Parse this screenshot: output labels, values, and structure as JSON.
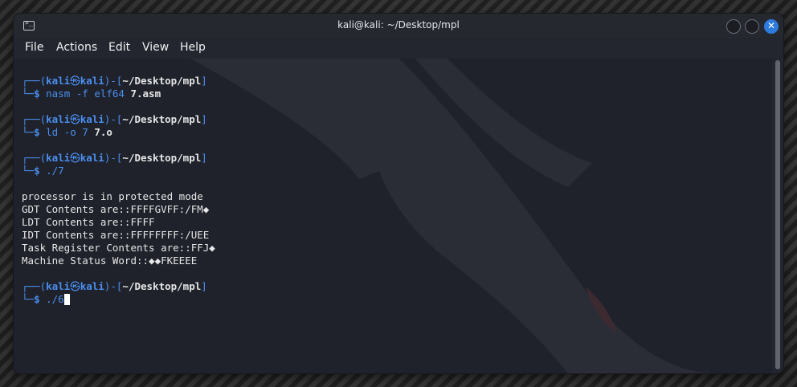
{
  "window": {
    "title": "kali@kali: ~/Desktop/mpl"
  },
  "menu": {
    "file": "File",
    "actions": "Actions",
    "edit": "Edit",
    "view": "View",
    "help": "Help"
  },
  "prompt": {
    "open": "┌──(",
    "user": "kali",
    "at": "㉿",
    "host": "kali",
    "mid": ")-[",
    "dir": "~/Desktop/mpl",
    "close": "]",
    "line2": "└─",
    "dollar": "$"
  },
  "commands": [
    {
      "cmd": "nasm -f elf64 ",
      "arg": "7.asm"
    },
    {
      "cmd": "ld -o 7 ",
      "arg": "7.o"
    },
    {
      "cmd": "./7",
      "arg": ""
    },
    {
      "cmd": "./6",
      "arg": ""
    }
  ],
  "output": [
    "processor is in protected mode",
    "GDT Contents are::FFFFGVFF:/FM◆",
    "LDT Contents are::FFFF",
    "IDT Contents are::FFFFFFFF:/UEE",
    "Task Register Contents are::FFJ◆",
    "Machine Status Word::◆◆FKEEEE"
  ],
  "colors": {
    "accent": "#4a8ff0",
    "close_button": "#2e7be0",
    "terminal_bg": "#1f222b",
    "watermark": "#2d2f37"
  },
  "icons": {
    "terminal": "terminal-icon",
    "close": "close-icon"
  }
}
